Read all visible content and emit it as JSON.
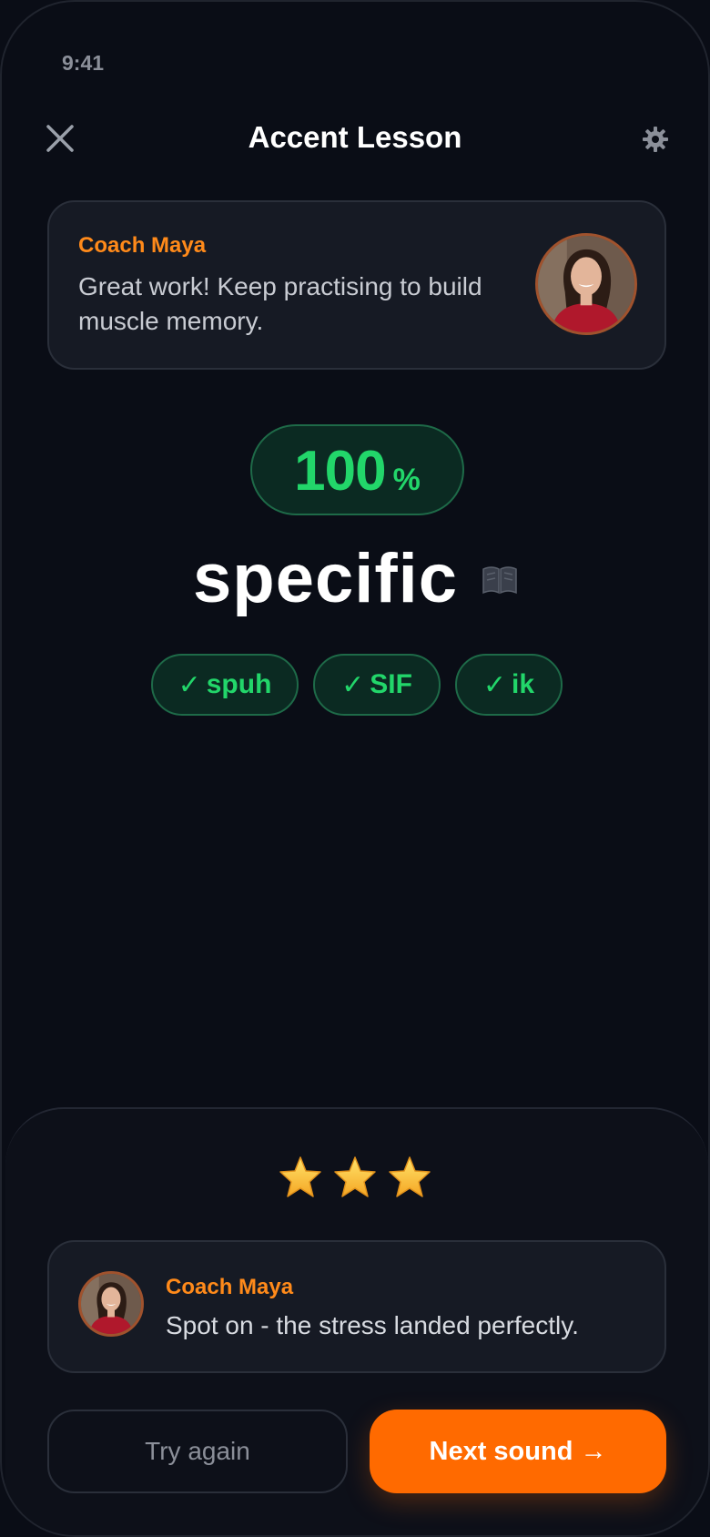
{
  "status_bar": {
    "time": "9:41"
  },
  "header": {
    "title": "Accent Lesson",
    "close_icon": "close-icon",
    "settings_icon": "gear-icon"
  },
  "coach_card": {
    "name": "Coach Maya",
    "message": "Great work! Keep practising to build muscle memory."
  },
  "score": {
    "value": "100",
    "unit": "%"
  },
  "word": {
    "text": "specific",
    "icon": "book-icon"
  },
  "syllables": [
    {
      "check": "✓",
      "text": "spuh",
      "status": "correct"
    },
    {
      "check": "✓",
      "text": "SIF",
      "status": "correct"
    },
    {
      "check": "✓",
      "text": "ik",
      "status": "correct"
    }
  ],
  "rating": {
    "stars": 3,
    "max_stars": 3
  },
  "feedback": {
    "name": "Coach Maya",
    "message": "Spot on - the stress landed perfectly."
  },
  "buttons": {
    "try_again": "Try again",
    "next": "Next sound →"
  },
  "colors": {
    "accent": "#ff6a00",
    "coach_name": "#ff8a1a",
    "success": "#22d66a",
    "success_bg": "#0b2a22",
    "background": "#0a0d16",
    "card": "#161a24"
  }
}
